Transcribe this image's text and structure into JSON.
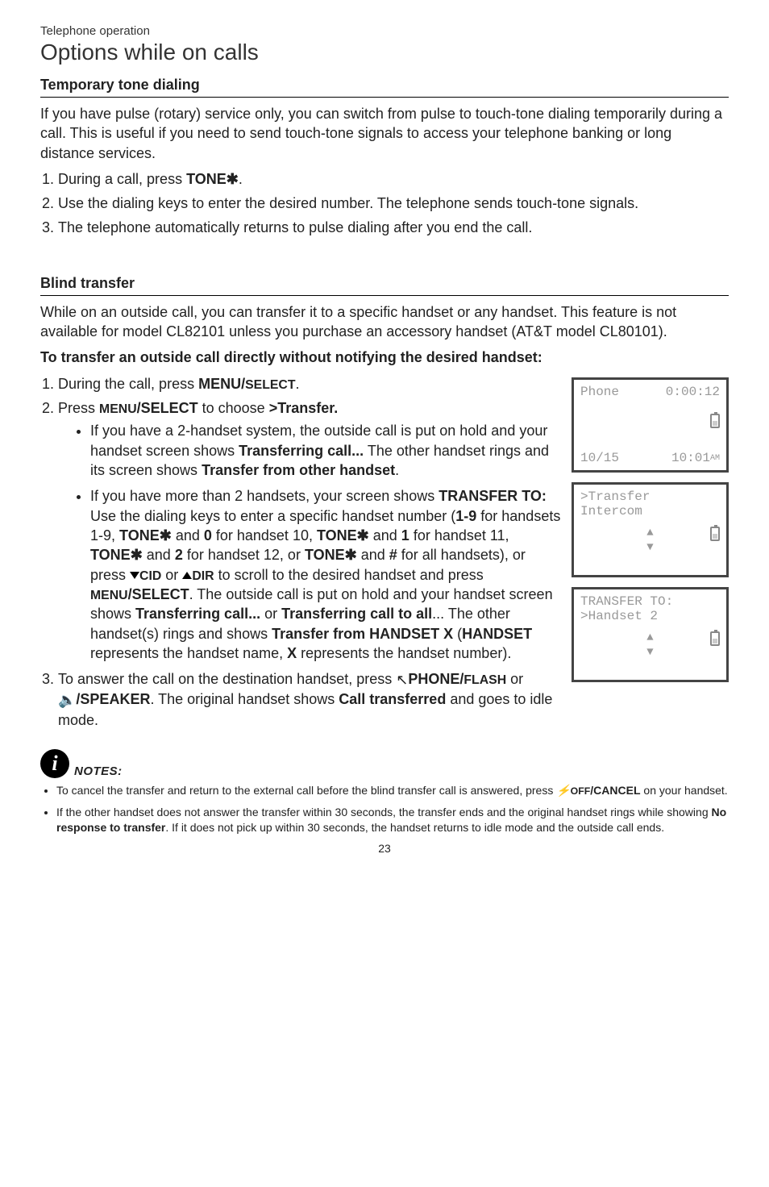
{
  "supertitle": "Telephone operation",
  "title": "Options while on calls",
  "section1": {
    "heading": "Temporary tone dialing",
    "para": "If you have pulse (rotary) service only, you can switch from pulse to touch-tone dialing temporarily during a call. This is useful if you need to send touch-tone signals to access your telephone banking or long distance services.",
    "step1_a": "During a call, press ",
    "step1_b": "TONE",
    "step1_c": ".",
    "step2": "Use the dialing keys to enter the desired number. The telephone sends touch-tone signals.",
    "step3": "The telephone automatically returns to pulse dialing after you end the call."
  },
  "section2": {
    "heading": "Blind transfer",
    "para": "While on an outside call, you can transfer it to a specific handset or any handset. This feature is not available for model CL82101 unless you purchase an accessory handset (AT&T model CL80101).",
    "subhead2": "To transfer an outside call directly without notifying the desired handset:",
    "step1_a": "During the call, press ",
    "step1_b": "MENU/",
    "step1_c": "SELECT",
    "step1_d": ".",
    "step2_a": "Press ",
    "step2_b": "MENU",
    "step2_c": "/SELECT",
    "step2_d": " to choose ",
    "step2_e": ">Transfer.",
    "bullet1_a": "If you have a 2-handset system, the outside call is put on hold and your handset screen shows ",
    "bullet1_b": "Transferring call...",
    "bullet1_c": " The other handset rings and its screen shows ",
    "bullet1_d": "Transfer from other handset",
    "bullet1_e": ".",
    "bullet2_a": "If you have more than 2 handsets, your screen shows ",
    "bullet2_b": "TRANSFER TO:",
    "bullet2_c": " Use the dialing keys to enter a specific handset number (",
    "bullet2_d": "1-9",
    "bullet2_e": " for handsets 1-9, ",
    "bullet2_f": "TONE",
    "bullet2_g": " and ",
    "bullet2_h": "0",
    "bullet2_i": " for handset 10, ",
    "bullet2_j": "TONE",
    "bullet2_k": " and ",
    "bullet2_l": "1",
    "bullet2_m": " for handset 11, ",
    "bullet2_n": "TONE",
    "bullet2_o": " and ",
    "bullet2_p": "2",
    "bullet2_q": " for handset 12, or ",
    "bullet2_r": "TONE",
    "bullet2_s": " and ",
    "bullet2_t": "#",
    "bullet2_u": " for all handsets), or press ",
    "bullet2_v": "CID",
    "bullet2_w": " or ",
    "bullet2_x": "DIR",
    "bullet2_y": " to scroll to the desired handset and press ",
    "bullet2_z": "MENU",
    "bullet2_aa": "/SELECT",
    "bullet2_ab": ". The outside call is put on hold and your handset screen shows ",
    "bullet2_ac": "Transferring call...",
    "bullet2_ad": " or ",
    "bullet2_ae": "Transferring call to all",
    "bullet2_af": "... The other handset(s) rings and shows ",
    "bullet2_ag": "Transfer from HANDSET X",
    "bullet2_ah": " (",
    "bullet2_ai": "HANDSET",
    "bullet2_aj": " represents the handset name, ",
    "bullet2_ak": "X",
    "bullet2_al": " represents the handset number).",
    "step3_a": "To answer the call on the destination handset, press ",
    "step3_b": "PHONE/",
    "step3_c": "FLASH",
    "step3_d": " or ",
    "step3_e": "/SPEAKER",
    "step3_f": ". The original handset shows ",
    "step3_g": "Call transferred",
    "step3_h": " and goes to idle mode."
  },
  "notes": {
    "label": "NOTES:",
    "n1_a": "To cancel the transfer and return to the external call before the blind transfer call is answered, press ",
    "n1_b": "OFF",
    "n1_c": "/CANCEL",
    "n1_d": " on your handset.",
    "n2_a": "If the other handset does not answer the transfer within 30 seconds, the transfer ends and the original handset rings while showing ",
    "n2_b": "No response to transfer",
    "n2_c": ". If it does not pick up within 30 seconds, the handset returns to idle mode and the outside call ends."
  },
  "lcd1": {
    "l1a": "Phone",
    "l1b": "0:00:12",
    "l2a": "10/15",
    "l2b": "10:01",
    "l2c": "AM"
  },
  "lcd2": {
    "l1": ">Transfer",
    "l2": " Intercom"
  },
  "lcd3": {
    "l1": "TRANSFER TO:",
    "l2": ">Handset  2"
  },
  "star": "✱",
  "page": "23"
}
